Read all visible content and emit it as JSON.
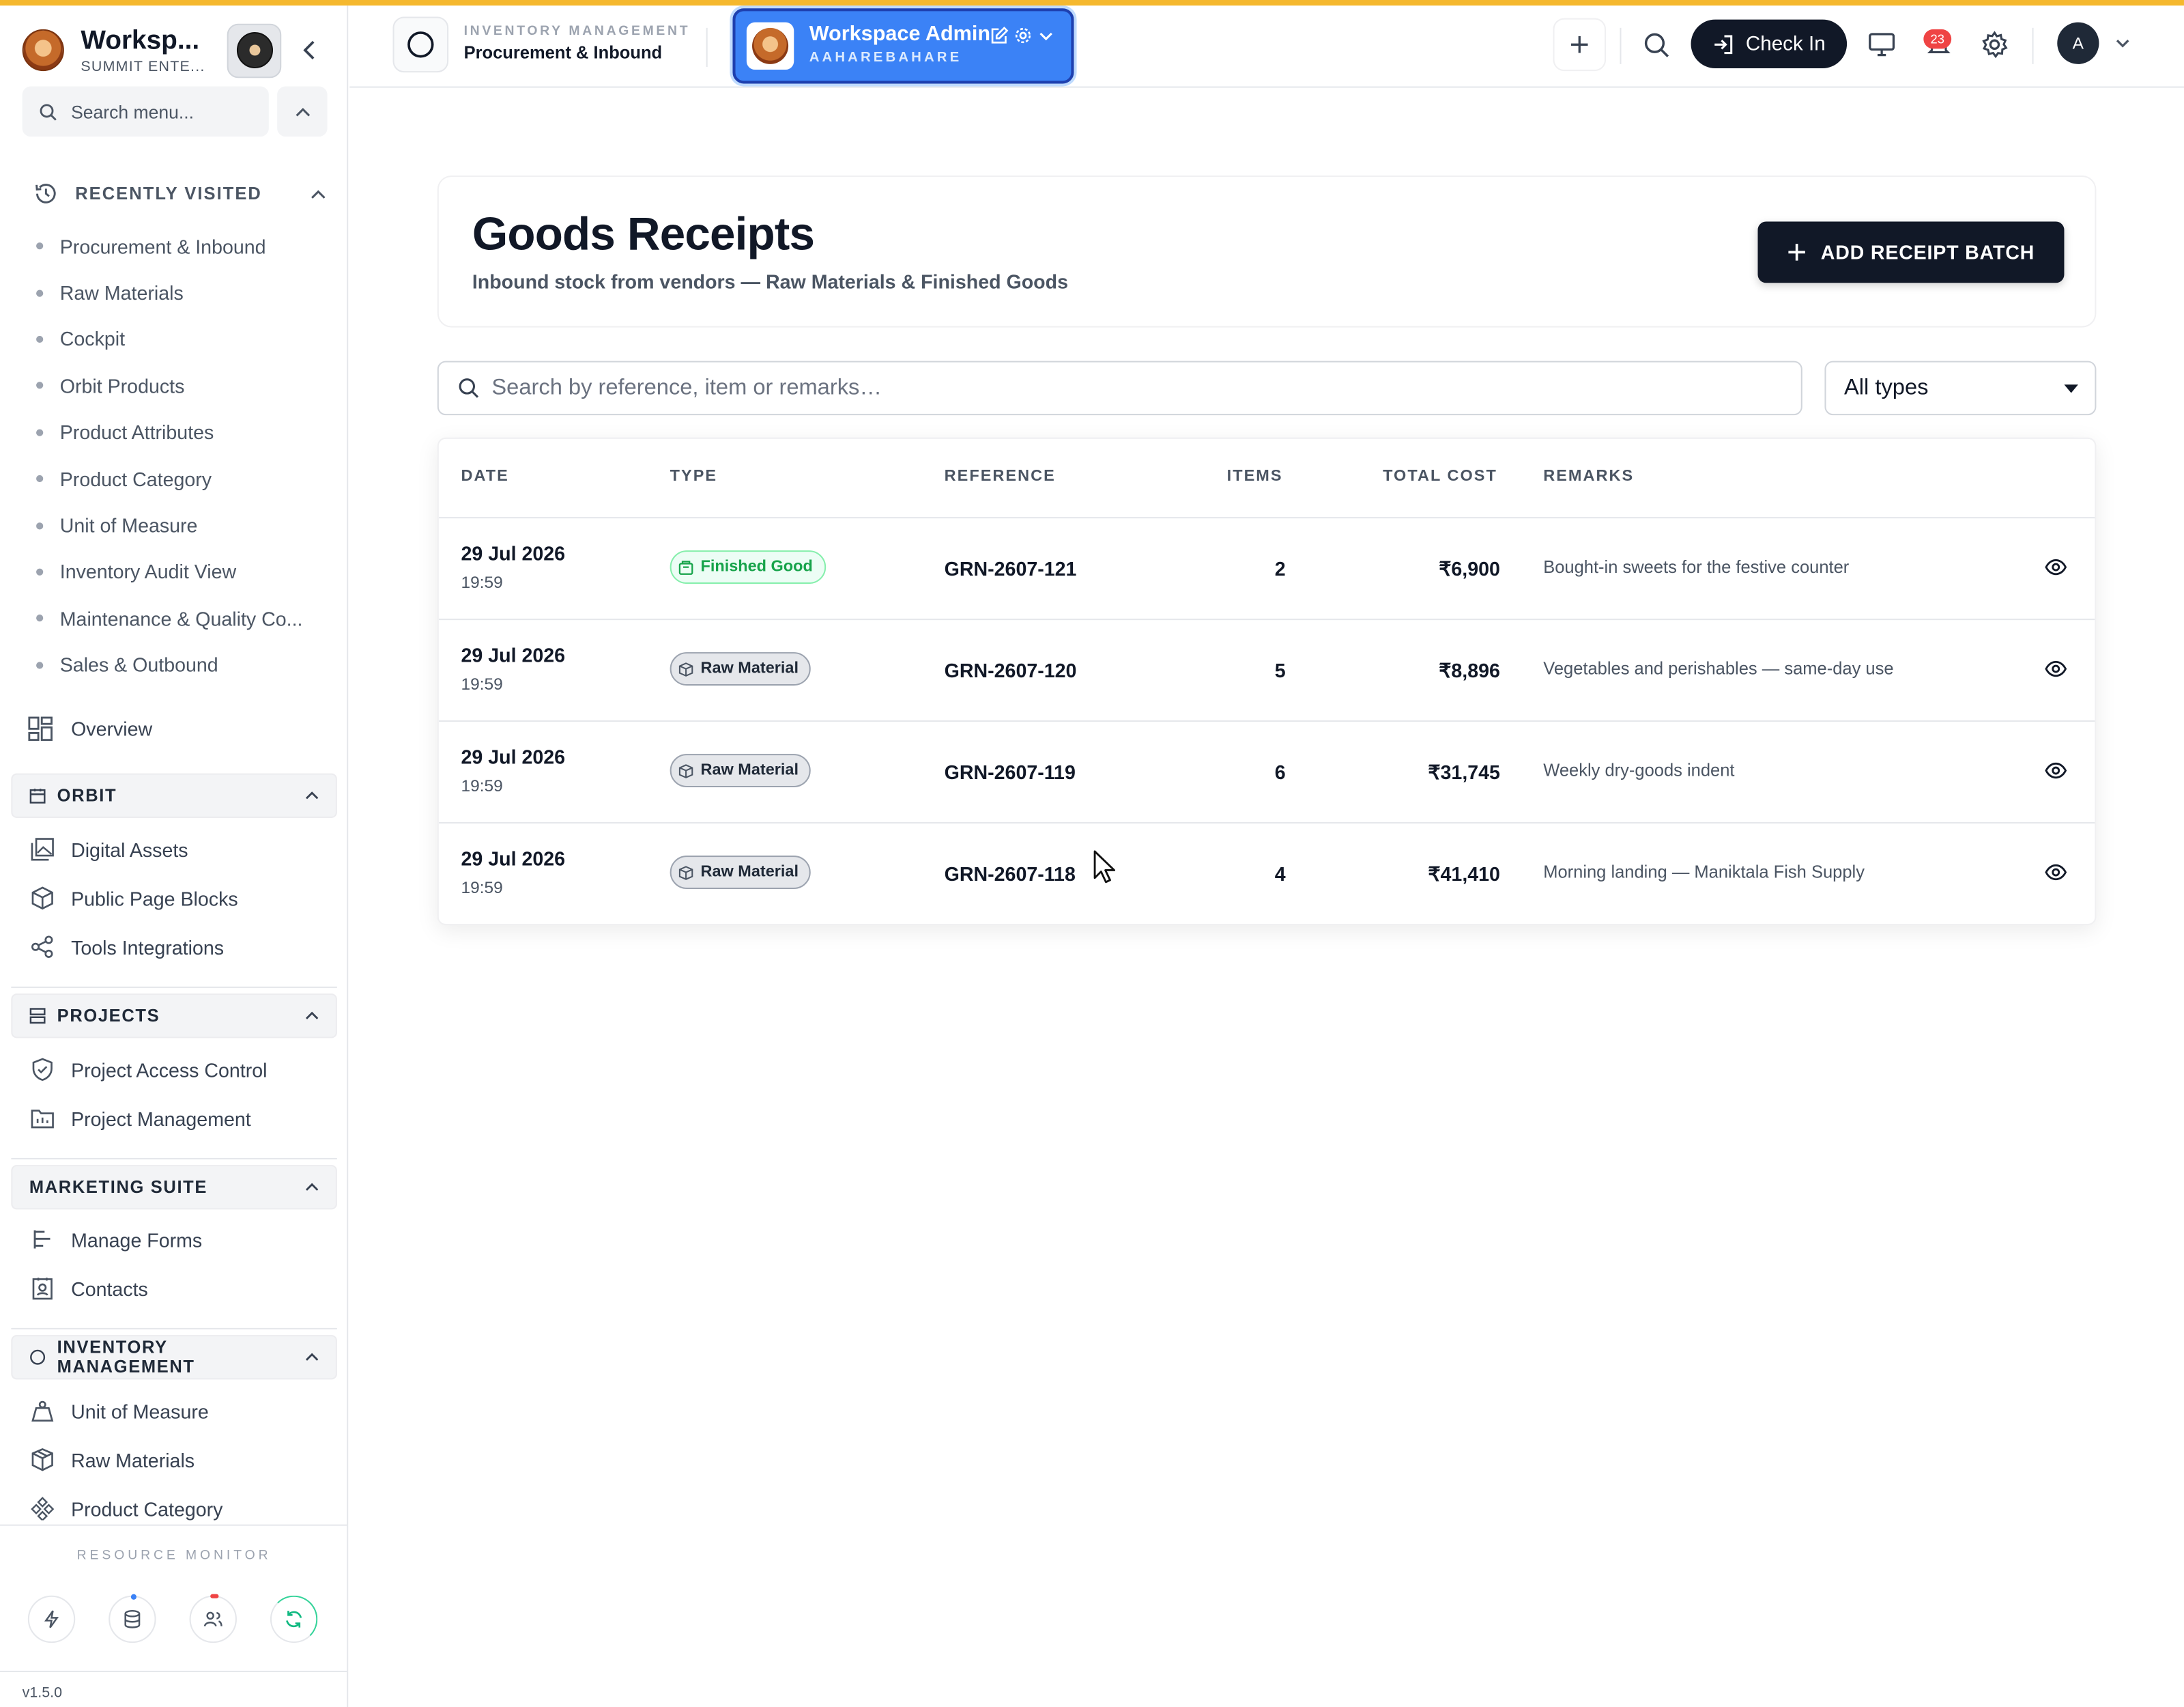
{
  "sidebar": {
    "workspace_title": "Worksp...",
    "workspace_subtitle": "SUMMIT ENTE...",
    "search_placeholder": "Search menu...",
    "recently_visited": {
      "label": "RECENTLY VISITED",
      "items": [
        "Procurement & Inbound",
        "Raw Materials",
        "Cockpit",
        "Orbit Products",
        "Product Attributes",
        "Product Category",
        "Unit of Measure",
        "Inventory Audit View",
        "Maintenance & Quality Co...",
        "Sales & Outbound"
      ]
    },
    "overview_label": "Overview",
    "sections": {
      "orbit": {
        "label": "ORBIT",
        "items": [
          "Digital Assets",
          "Public Page Blocks",
          "Tools Integrations"
        ]
      },
      "projects": {
        "label": "PROJECTS",
        "items": [
          "Project Access Control",
          "Project Management"
        ]
      },
      "marketing": {
        "label": "MARKETING SUITE",
        "items": [
          "Manage Forms",
          "Contacts"
        ]
      },
      "inventory": {
        "label": "INVENTORY MANAGEMENT",
        "items": [
          "Unit of Measure",
          "Raw Materials",
          "Product Category"
        ]
      }
    },
    "resource_monitor_label": "RESOURCE MONITOR",
    "version": "v1.5.0"
  },
  "topbar": {
    "module_label": "INVENTORY MANAGEMENT",
    "module_page": "Procurement & Inbound",
    "workspace_name": "Workspace Admin",
    "workspace_code": "AAHAREBAHARE",
    "checkin_label": "Check In",
    "notification_count": "23",
    "avatar_initial": "A"
  },
  "page": {
    "title": "Goods Receipts",
    "subtitle": "Inbound stock from vendors — Raw Materials & Finished Goods",
    "add_button": "ADD RECEIPT BATCH",
    "search_placeholder": "Search by reference, item or remarks…",
    "type_filter": "All types"
  },
  "table": {
    "headers": {
      "date": "DATE",
      "type": "TYPE",
      "reference": "REFERENCE",
      "items": "ITEMS",
      "total_cost": "TOTAL COST",
      "remarks": "REMARKS"
    },
    "rows": [
      {
        "date": "29 Jul 2026",
        "time": "19:59",
        "type": "Finished Good",
        "reference": "GRN-2607-121",
        "items": "2",
        "total_cost": "₹6,900",
        "remarks": "Bought-in sweets for the festive counter"
      },
      {
        "date": "29 Jul 2026",
        "time": "19:59",
        "type": "Raw Material",
        "reference": "GRN-2607-120",
        "items": "5",
        "total_cost": "₹8,896",
        "remarks": "Vegetables and perishables — same-day use"
      },
      {
        "date": "29 Jul 2026",
        "time": "19:59",
        "type": "Raw Material",
        "reference": "GRN-2607-119",
        "items": "6",
        "total_cost": "₹31,745",
        "remarks": "Weekly dry-goods indent"
      },
      {
        "date": "29 Jul 2026",
        "time": "19:59",
        "type": "Raw Material",
        "reference": "GRN-2607-118",
        "items": "4",
        "total_cost": "₹41,410",
        "remarks": "Morning landing — Maniktala Fish Supply"
      }
    ]
  },
  "colors": {
    "accent_top": "#f5b82e",
    "primary_dark": "#111827",
    "workspace_blue": "#3b82f6",
    "finished_good_green": "#16a34a",
    "badge_red": "#ef4444"
  }
}
